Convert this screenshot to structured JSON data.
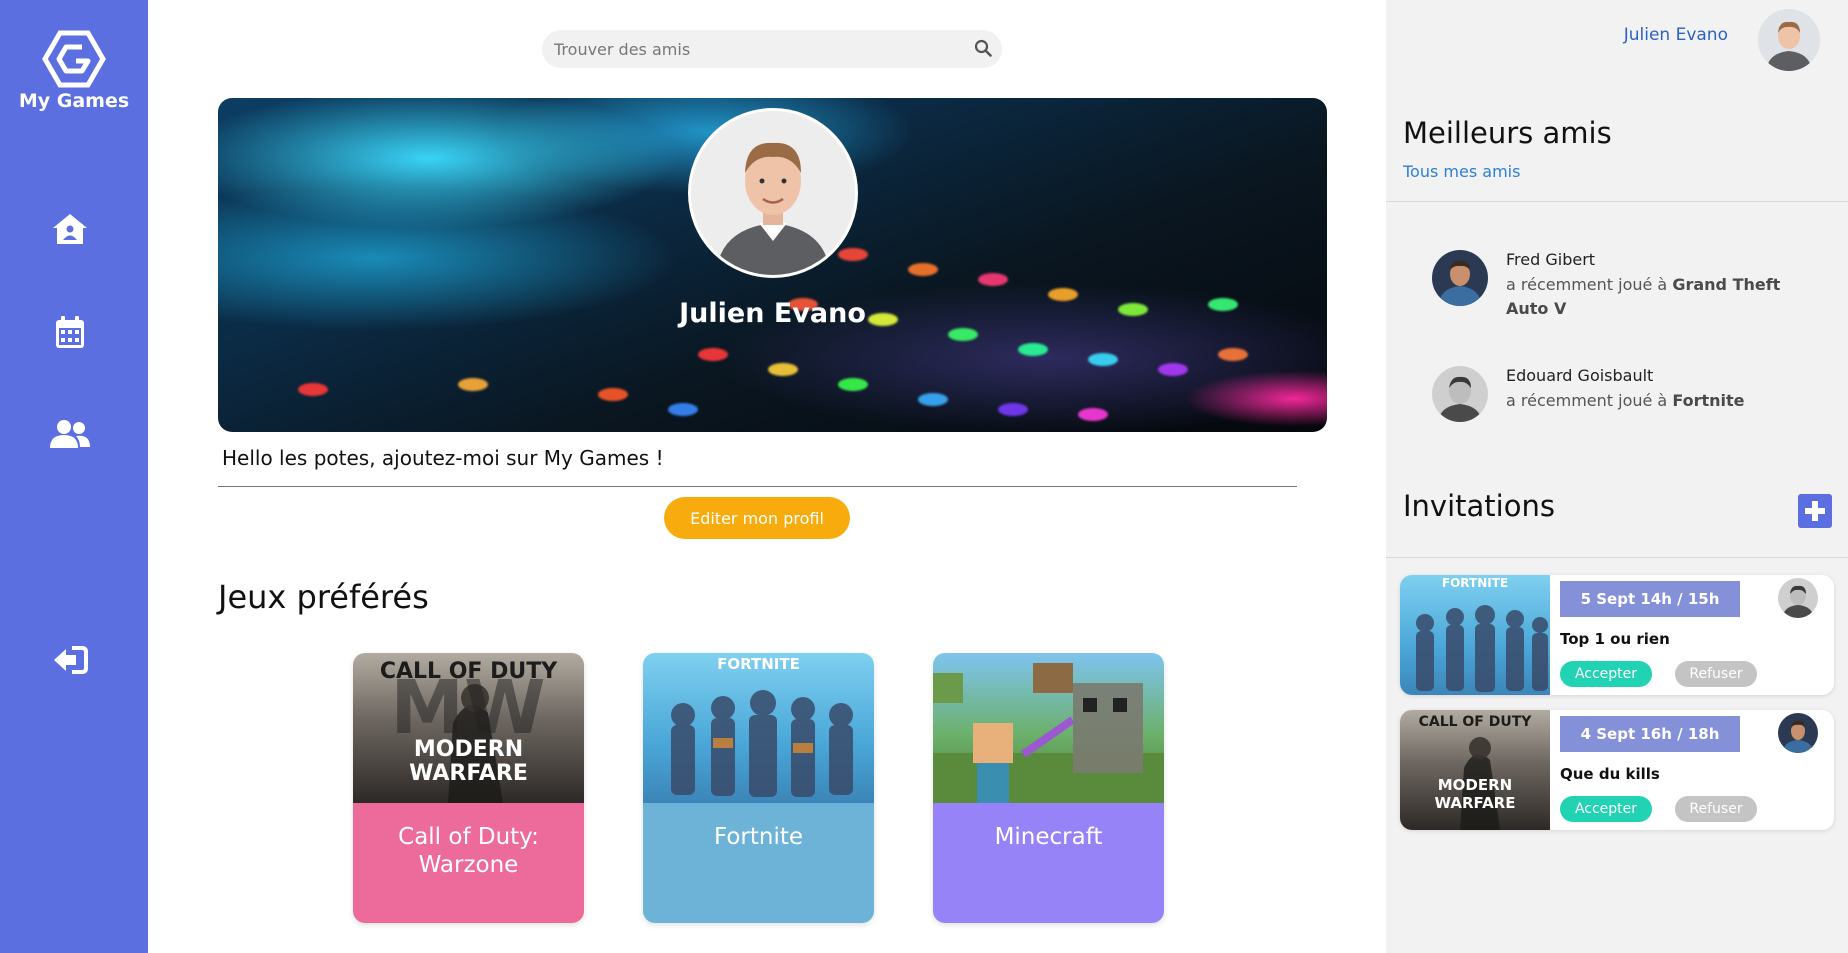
{
  "app": {
    "name": "My Games",
    "accent_color": "#5b6fe0"
  },
  "sidebar": {
    "items": [
      {
        "icon": "home-icon"
      },
      {
        "icon": "calendar-icon"
      },
      {
        "icon": "friends-icon"
      },
      {
        "icon": "logout-icon"
      }
    ]
  },
  "search": {
    "placeholder": "Trouver des amis",
    "value": ""
  },
  "profile": {
    "name": "Julien Evano",
    "bio": "Hello les potes, ajoutez-moi sur My Games !",
    "edit_label": "Editer mon profil"
  },
  "favorites": {
    "title": "Jeux préférés",
    "games": [
      {
        "name": "Call of Duty: Warzone",
        "color": "#ed6b9b",
        "poster_line1": "CALL OF DUTY",
        "poster_line2": "MODERN",
        "poster_line3": "WARFARE"
      },
      {
        "name": "Fortnite",
        "color": "#6db3d8",
        "poster_line1": "FORTNITE"
      },
      {
        "name": "Minecraft",
        "color": "#9683f7"
      }
    ]
  },
  "header_user": {
    "name": "Julien Evano"
  },
  "best_friends": {
    "title": "Meilleurs amis",
    "link": "Tous mes amis",
    "friends": [
      {
        "name": "Fred Gibert",
        "activity_prefix": "a récemment joué à",
        "game": "Grand Theft Auto V"
      },
      {
        "name": "Edouard Goisbault",
        "activity_prefix": "a récemment joué à",
        "game": "Fortnite"
      }
    ]
  },
  "invitations": {
    "title": "Invitations",
    "items": [
      {
        "date": "5 Sept 14h / 15h",
        "title": "Top 1 ou rien",
        "accept": "Accepter",
        "refuse": "Refuser",
        "poster_line1": "FORTNITE"
      },
      {
        "date": "4 Sept 16h / 18h",
        "title": "Que du kills",
        "accept": "Accepter",
        "refuse": "Refuser",
        "poster_line1": "CALL OF DUTY",
        "poster_line2": "MODERN",
        "poster_line3": "WARFARE"
      }
    ]
  }
}
